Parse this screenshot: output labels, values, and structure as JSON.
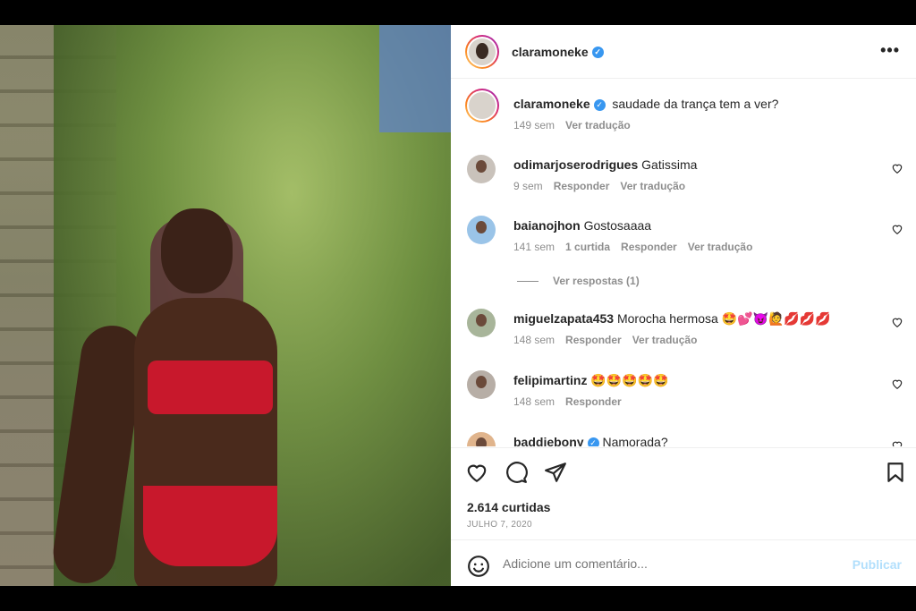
{
  "post": {
    "username": "claramoneke",
    "verified_icon": "verified-badge-icon",
    "more_label": "•••"
  },
  "caption": {
    "username": "claramoneke",
    "text": "saudade da trança tem a ver?",
    "time": "149 sem",
    "translate": "Ver tradução"
  },
  "comments": [
    {
      "username": "odimarjoserodrigues",
      "text": "Gatissima",
      "time": "9 sem",
      "actions": [
        "Responder",
        "Ver tradução"
      ]
    },
    {
      "username": "baianojhon",
      "text": "Gostosaaaa",
      "time": "141 sem",
      "actions": [
        "1 curtida",
        "Responder",
        "Ver tradução"
      ]
    },
    {
      "username": "miguelzapata453",
      "text": "Morocha hermosa 🤩💕😈🙋💋💋💋",
      "time": "148 sem",
      "actions": [
        "Responder",
        "Ver tradução"
      ]
    },
    {
      "username": "felipimartinz",
      "text": "🤩🤩🤩🤩🤩",
      "time": "148 sem",
      "actions": [
        "Responder"
      ]
    },
    {
      "username": "baddiebony",
      "text": "Namorada?",
      "time": "",
      "actions": []
    }
  ],
  "replies_label": "Ver respostas (1)",
  "likes": "2.614 curtidas",
  "date": "JULHO 7, 2020",
  "comment_input": {
    "placeholder": "Adicione um comentário..."
  },
  "publish_label": "Publicar",
  "colors": {
    "link_blue": "#3897f0",
    "publish_disabled": "#b2dffc",
    "muted": "#8e8e8e",
    "text": "#262626"
  }
}
